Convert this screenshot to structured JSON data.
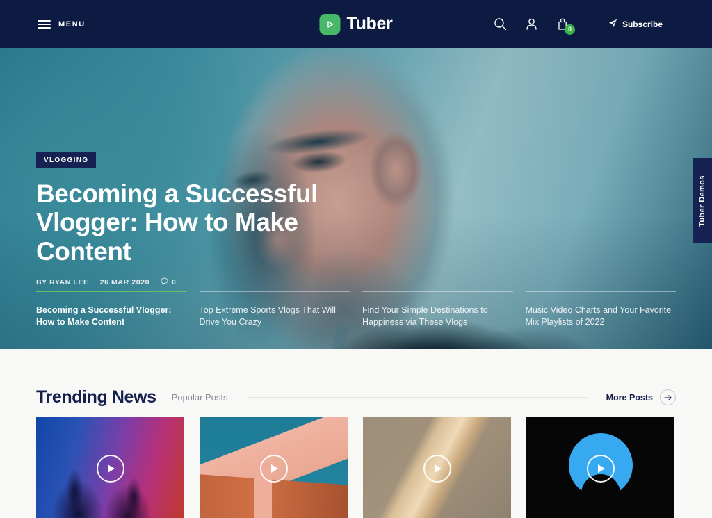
{
  "header": {
    "menu_label": "MENU",
    "brand_name": "Tuber",
    "logo_icon": "play-icon",
    "search_icon": "search-icon",
    "account_icon": "user-icon",
    "cart_icon": "shopping-bag-icon",
    "cart_count": "0",
    "subscribe_label": "Subscribe",
    "subscribe_icon": "paper-plane-icon"
  },
  "hero": {
    "category": "VLOGGING",
    "title": "Becoming a Successful Vlogger: How to Make Content",
    "author": "BY RYAN LEE",
    "date": "26 MAR 2020",
    "comments": "0",
    "comment_icon": "comment-icon",
    "slides": [
      {
        "title": "Becoming a Successful Vlogger: How to Make Content",
        "active": true
      },
      {
        "title": "Top Extreme Sports Vlogs That Will Drive You Crazy",
        "active": false
      },
      {
        "title": "Find Your Simple Destinations to Happiness via These Vlogs",
        "active": false
      },
      {
        "title": "Music Video Charts and Your Favorite Mix Playlists of 2022",
        "active": false
      }
    ]
  },
  "side_tab": {
    "label": "Tuber Demos"
  },
  "trending": {
    "title": "Trending News",
    "secondary_tab": "Popular Posts",
    "more_label": "More Posts",
    "more_icon": "arrow-right-icon",
    "cards": [
      {
        "play_icon": "play-icon"
      },
      {
        "play_icon": "play-icon"
      },
      {
        "play_icon": "play-icon"
      },
      {
        "play_icon": "play-icon"
      }
    ]
  },
  "colors": {
    "navy": "#0d1b42",
    "deep_navy": "#152252",
    "green": "#48b868",
    "badge_green": "#3bb54a",
    "page_bg": "#f8f8f6",
    "heading": "#16204c"
  }
}
